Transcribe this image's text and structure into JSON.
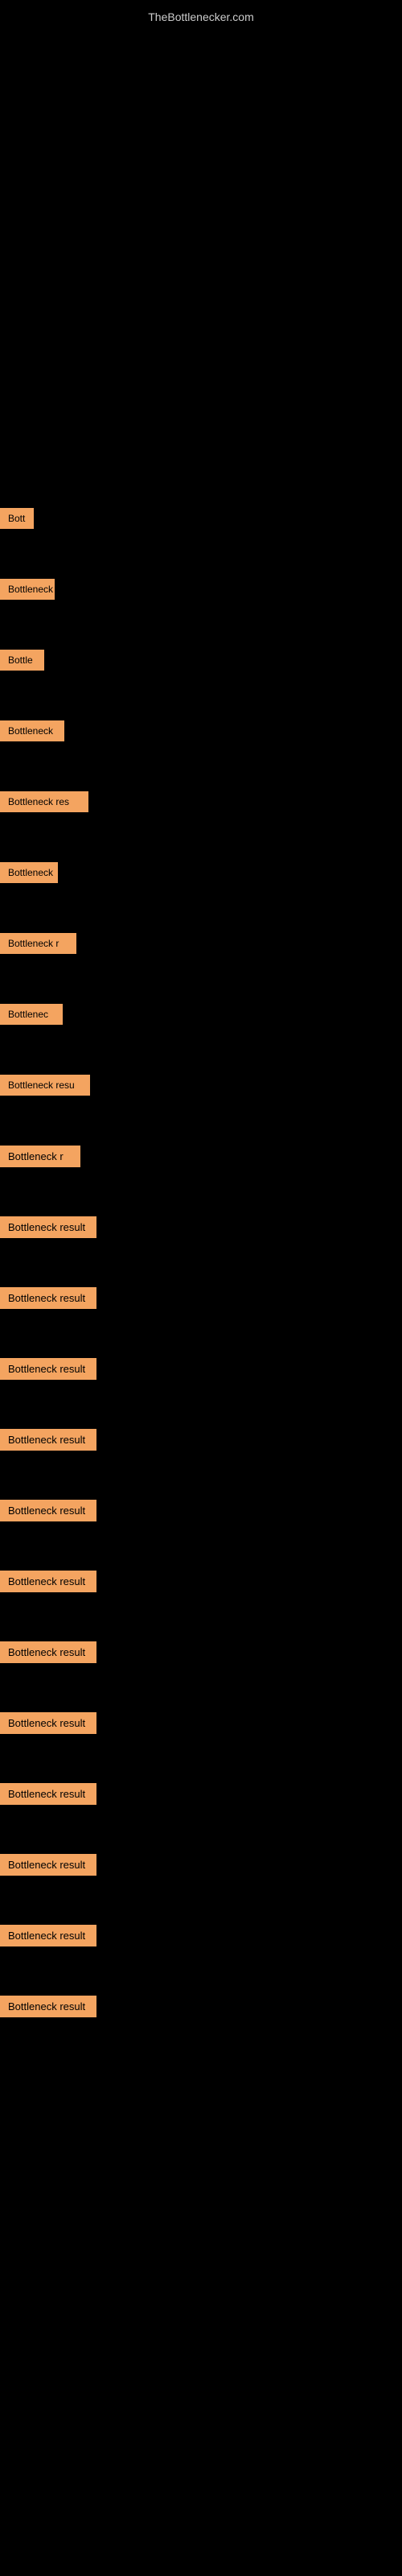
{
  "site": {
    "title": "TheBottlenecker.com"
  },
  "items": [
    {
      "id": 1,
      "label": "Bott",
      "class": "item-1"
    },
    {
      "id": 2,
      "label": "Bottleneck",
      "class": "item-2"
    },
    {
      "id": 3,
      "label": "Bottle",
      "class": "item-3"
    },
    {
      "id": 4,
      "label": "Bottleneck",
      "class": "item-4"
    },
    {
      "id": 5,
      "label": "Bottleneck res",
      "class": "item-5"
    },
    {
      "id": 6,
      "label": "Bottleneck",
      "class": "item-6"
    },
    {
      "id": 7,
      "label": "Bottleneck r",
      "class": "item-7"
    },
    {
      "id": 8,
      "label": "Bottlenec",
      "class": "item-8"
    },
    {
      "id": 9,
      "label": "Bottleneck resu",
      "class": "item-9"
    },
    {
      "id": 10,
      "label": "Bottleneck r",
      "class": "item-10"
    },
    {
      "id": 11,
      "label": "Bottleneck result",
      "class": "item-11"
    },
    {
      "id": 12,
      "label": "Bottleneck result",
      "class": "item-12"
    },
    {
      "id": 13,
      "label": "Bottleneck result",
      "class": "item-13"
    },
    {
      "id": 14,
      "label": "Bottleneck result",
      "class": "item-14"
    },
    {
      "id": 15,
      "label": "Bottleneck result",
      "class": "item-15"
    },
    {
      "id": 16,
      "label": "Bottleneck result",
      "class": "item-16"
    },
    {
      "id": 17,
      "label": "Bottleneck result",
      "class": "item-17"
    },
    {
      "id": 18,
      "label": "Bottleneck result",
      "class": "item-18"
    },
    {
      "id": 19,
      "label": "Bottleneck result",
      "class": "item-19"
    },
    {
      "id": 20,
      "label": "Bottleneck result",
      "class": "item-20"
    },
    {
      "id": 21,
      "label": "Bottleneck result",
      "class": "item-21"
    },
    {
      "id": 22,
      "label": "Bottleneck result",
      "class": "item-22"
    }
  ]
}
